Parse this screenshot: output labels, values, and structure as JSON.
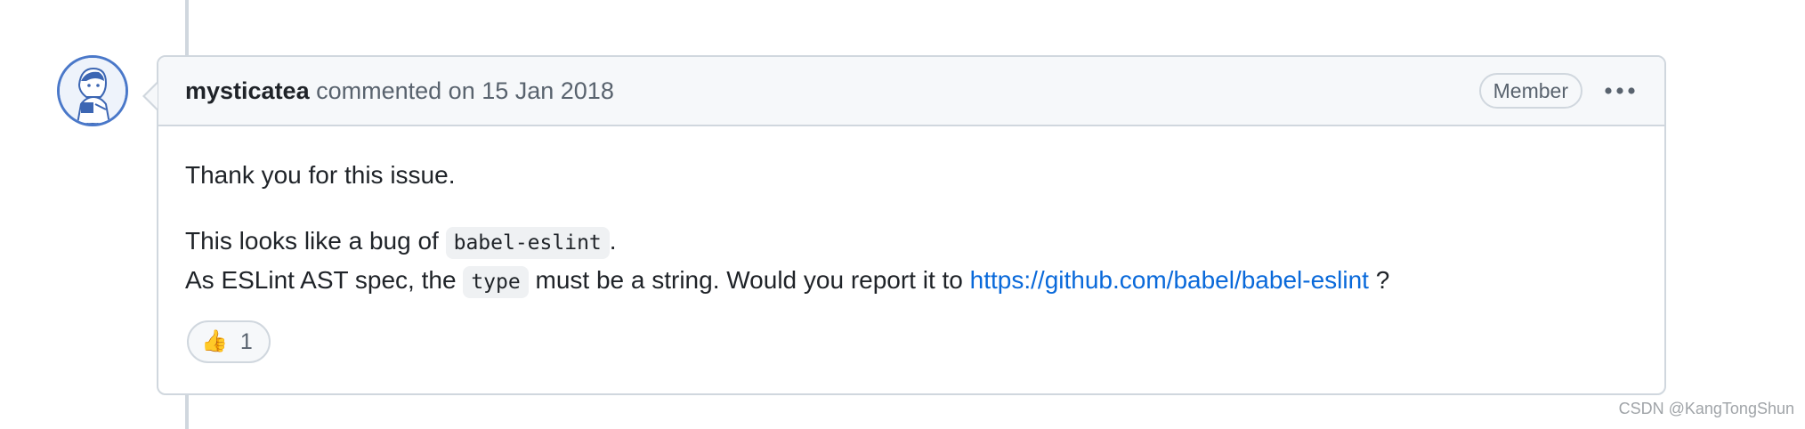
{
  "comment": {
    "author": "mysticatea",
    "action_text": "commented on 15 Jan 2018",
    "role_badge": "Member",
    "body": {
      "line1": "Thank you for this issue.",
      "line2_before": "This looks like a bug of ",
      "line2_code": "babel-eslint",
      "line2_after": ".",
      "line3_before": "As ESLint AST spec, the ",
      "line3_code": "type",
      "line3_middle": " must be a string. Would you report it to ",
      "line3_link": "https://github.com/babel/babel-eslint",
      "line3_after": " ?"
    },
    "reactions": [
      {
        "icon": "thumbs-up-icon",
        "emoji": "👍",
        "count": "1"
      }
    ]
  },
  "watermark": "CSDN @KangTongShun",
  "colors": {
    "link": "#0969da",
    "border": "#d0d7de",
    "header_bg": "#f6f8fa",
    "avatar_ring": "#4a78c9"
  }
}
